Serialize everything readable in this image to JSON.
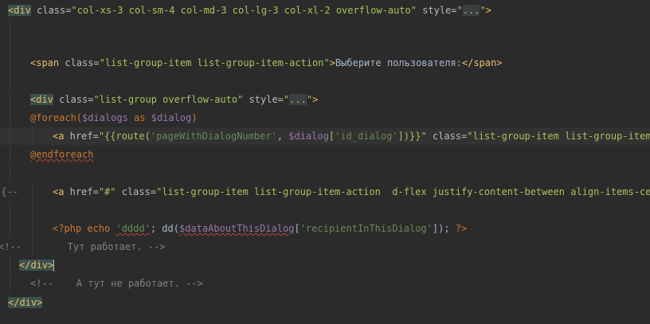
{
  "lines": {
    "l1": {
      "tag": "<div",
      "attr": " class=",
      "val": "\"col-xs-3 col-sm-4 col-md-3 col-lg-3 col-xl-2 overflow-auto\"",
      "attr2": " style=",
      "q1": "\"",
      "dots": "...",
      "q2": "\"",
      "close": ">"
    },
    "l2": {
      "tag": "<span",
      "attr": " class=",
      "val": "\"list-group-item list-group-item-action\"",
      "close": ">",
      "text": "Выберите пользователя:",
      "endtag": "</span>"
    },
    "l3": {
      "tag": "<div",
      "attr": " class=",
      "val": "\"list-group overflow-auto\"",
      "attr2": " style=",
      "q1": "\"",
      "dots": "...",
      "q2": "\"",
      "close": ">"
    },
    "l4": {
      "dir": "@foreach(",
      "var": "$dialogs",
      "kw": " as ",
      "var2": "$dialog",
      "end": ")"
    },
    "l5": {
      "tag": "<a",
      "attr": " href=",
      "v1": "\"{{route(",
      "s1": "'pageWithDialogNumber'",
      "v2": ", ",
      "var": "$dialog",
      "v3": "[",
      "s2": "'id_dialog'",
      "v4": "])}}\"",
      "attr2": " class=",
      "v5": "\"list-group-item list-group-item-act"
    },
    "l6": {
      "dir": "@endforeach"
    },
    "l7": {
      "blade": "{{--",
      "tag": "<a",
      "attr": " href=",
      "val": "\"#\"",
      "attr2": " class=",
      "val2": "\"list-group-item list-group-item-action  d-flex justify-content-between align-items-center"
    },
    "l8": {
      "open": "<?php",
      "echo": " echo ",
      "str": "'dddd'",
      "semi": "; dd(",
      "var": "$dataAboutThisDialog",
      "br1": "[",
      "str2": "'recipientInThisDialog'",
      "br2": "]); ",
      "close": "?>"
    },
    "l9": {
      "cmt": "<!--        Тут работает. -->"
    },
    "l10": {
      "tag": "</div",
      "close": ">"
    },
    "l11": {
      "cmt": "<!--    А тут не работает. -->"
    },
    "l12": {
      "tag": "</div",
      "close": ">"
    }
  }
}
